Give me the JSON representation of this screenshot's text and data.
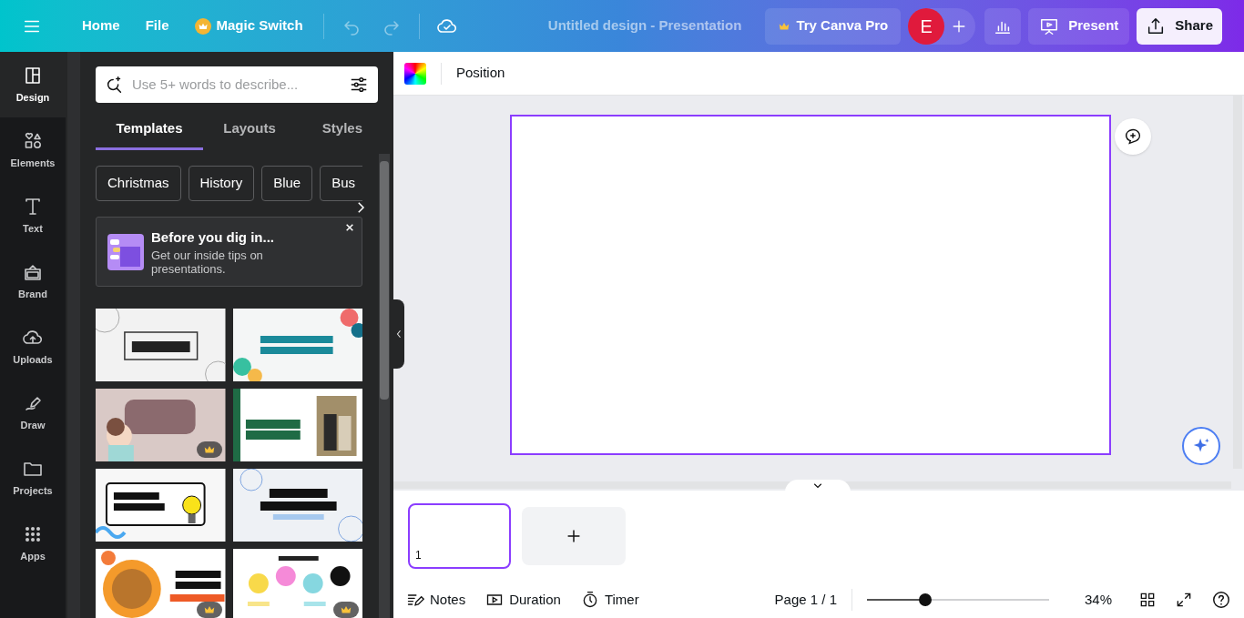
{
  "topbar": {
    "nav": [
      {
        "label": "Home",
        "premium": false
      },
      {
        "label": "File",
        "premium": false
      },
      {
        "label": "Magic Switch",
        "premium": true
      }
    ],
    "title": "Untitled design - Presentation",
    "try_pro": "Try Canva Pro",
    "avatar": "E",
    "present": "Present",
    "share": "Share"
  },
  "rail": [
    {
      "kind": "design",
      "label": "Design",
      "selected": true
    },
    {
      "kind": "elements",
      "label": "Elements",
      "selected": false
    },
    {
      "kind": "text",
      "label": "Text",
      "selected": false
    },
    {
      "kind": "brand",
      "label": "Brand",
      "selected": false
    },
    {
      "kind": "uploads",
      "label": "Uploads",
      "selected": false
    },
    {
      "kind": "draw",
      "label": "Draw",
      "selected": false
    },
    {
      "kind": "projects",
      "label": "Projects",
      "selected": false
    },
    {
      "kind": "apps",
      "label": "Apps",
      "selected": false
    }
  ],
  "panel": {
    "search": {
      "placeholder": "Use 5+ words to describe..."
    },
    "tabs": [
      {
        "label": "Templates",
        "selected": true
      },
      {
        "label": "Layouts",
        "selected": false
      },
      {
        "label": "Styles",
        "selected": false
      }
    ],
    "chips": [
      "Christmas",
      "History",
      "Blue",
      "Bus"
    ],
    "tip": {
      "title": "Before you dig in...",
      "body": "Get our inside tips on presentations."
    },
    "templates": [
      {
        "kind": "picture",
        "premium": false
      },
      {
        "kind": "picture",
        "premium": false
      },
      {
        "kind": "picture",
        "premium": true
      },
      {
        "kind": "picture",
        "premium": false
      },
      {
        "kind": "picture",
        "premium": false
      },
      {
        "kind": "picture",
        "premium": false
      },
      {
        "kind": "picture",
        "premium": true
      },
      {
        "kind": "picture",
        "premium": true
      }
    ]
  },
  "toolbar": {
    "position": "Position"
  },
  "pages": [
    {
      "number": "1",
      "selected": true
    }
  ],
  "bottom": {
    "notes": "Notes",
    "duration": "Duration",
    "timer": "Timer",
    "page": "Page 1 / 1",
    "zoom": {
      "level": 0.32
    },
    "zoom_label": "34%"
  }
}
